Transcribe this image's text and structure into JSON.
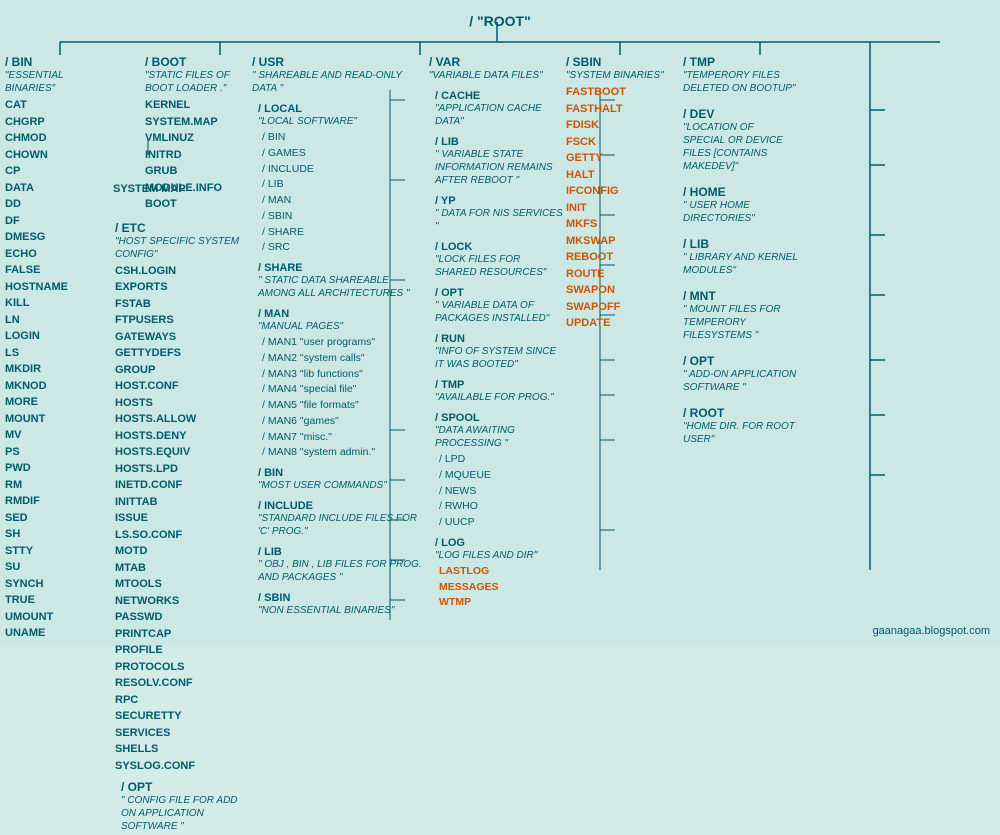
{
  "root": {
    "label": "/  \"ROOT\""
  },
  "watermark": "gaanagaa.blogspot.com",
  "columns": {
    "bin": {
      "title": "/ BIN",
      "desc": "\"ESSENTIAL BINARIES\"",
      "files": [
        "CAT",
        "CHGRP",
        "CHMOD",
        "CHOWN",
        "CP",
        "DATA",
        "DD",
        "DF",
        "DMESG",
        "ECHO",
        "FALSE",
        "HOSTNAME",
        "KILL",
        "LN",
        "LOGIN",
        "LS",
        "MKDIR",
        "MKNOD",
        "MORE",
        "MOUNT",
        "MV",
        "PS",
        "PWD",
        "RM",
        "RMDIF",
        "SED",
        "SH",
        "STTY",
        "SU",
        "SYNCH",
        "TRUE",
        "UMOUNT",
        "UNAME"
      ]
    },
    "boot": {
      "title": "/ BOOT",
      "desc": "\"STATIC FILES OF BOOT LOADER .\"",
      "files": [
        "KERNEL",
        "SYSTEM.MAP",
        "VMLINUZ",
        "INITRD",
        "GRUB",
        "MODULE.INFO",
        "BOOT"
      ]
    },
    "etc": {
      "title": "/ ETC",
      "desc": "\"HOST SPECIFIC SYSTEM CONFIG\"",
      "files": [
        "CSH.LOGIN",
        "EXPORTS",
        "FSTAB",
        "FTPUSERS",
        "GATEWAYS",
        "GETTYDEFS",
        "GROUP",
        "HOST.CONF",
        "HOSTS",
        "HOSTS.ALLOW",
        "HOSTS.DENY",
        "HOSTS.EQUIV",
        "HOSTS.LPD",
        "INETD.CONF",
        "INITTAB",
        "ISSUE",
        "LS.SO.CONF",
        "MOTD",
        "MTAB",
        "MTOOLS",
        "NETWORKS",
        "PASSWD",
        "PRINTCAP",
        "PROFILE",
        "PROTOCOLS",
        "RESOLV.CONF",
        "RPC",
        "SECURETTY",
        "SERVICES",
        "SHELLS",
        "SYSLOG.CONF"
      ]
    },
    "etc_opt": {
      "title": "/ OPT",
      "desc": "\" CONFIG FILE FOR ADD ON APPLICATION SOFTWARE \""
    },
    "usr": {
      "title": "/ USR",
      "desc": "\" SHAREABLE AND READ-ONLY DATA \"",
      "local": {
        "title": "/ LOCAL",
        "desc": "\"LOCAL SOFTWARE\"",
        "subdirs": [
          "/ BIN",
          "/ GAMES",
          "/ INCLUDE",
          "/ LIB",
          "/ MAN",
          "/ SBIN",
          "/ SHARE",
          "/ SRC"
        ]
      },
      "share": {
        "title": "/ SHARE",
        "desc": "\" STATIC DATA SHAREABLE AMONG ALL ARCHITECTURES \""
      },
      "man": {
        "title": "/ MAN",
        "desc": "\"MANUAL PAGES\"",
        "subdirs": [
          "/ MAN1 \"user programs\"",
          "/ MAN2 \"system calls\"",
          "/ MAN3 \"lib functions\"",
          "/ MAN4 \"special file\"",
          "/ MAN5 \"file formats\"",
          "/ MAN6 \"games\"",
          "/ MAN7 \"misc.\"",
          "/ MAN8 \"system admin.\""
        ]
      },
      "bin": {
        "title": "/ BIN",
        "desc": "\"MOST USER COMMANDS\""
      },
      "include": {
        "title": "/ INCLUDE",
        "desc": "\"STANDARD INCLUDE FILES FOR 'C' PROG.\""
      },
      "lib": {
        "title": "/ LIB",
        "desc": "\" OBJ , BIN , LIB FILES FOR PROG. AND PACKAGES \""
      },
      "sbin": {
        "title": "/ SBIN",
        "desc": "\"NON ESSENTIAL BINARIES\""
      }
    },
    "var": {
      "title": "/ VAR",
      "desc": "\"VARIABLE DATA FILES\"",
      "cache": {
        "title": "/ CACHE",
        "desc": "\"APPLICATION CACHE DATA\""
      },
      "lib": {
        "title": "/ LIB",
        "desc": "\" VARIABLE STATE INFORMATION REMAINS AFTER REBOOT \""
      },
      "yp": {
        "title": "/ YP",
        "desc": "\" DATA FOR NIS SERVICES \""
      },
      "lock": {
        "title": "/ LOCK",
        "desc": "\"LOCK FILES FOR SHARED RESOURCES\""
      },
      "opt": {
        "title": "/ OPT",
        "desc": "\" VARIABLE DATA OF PACKAGES INSTALLED\""
      },
      "run": {
        "title": "/ RUN",
        "desc": "\"INFO OF SYSTEM SINCE IT WAS BOOTED\""
      },
      "tmp": {
        "title": "/ TMP",
        "desc": "\"AVAILABLE FOR PROG.\""
      },
      "spool": {
        "title": "/ SPOOL",
        "desc": "\"DATA AWAITING PROCESSING \"",
        "subdirs": [
          "/ LPD",
          "/ MQUEUE",
          "/ NEWS",
          "/ RWHO",
          "/ UUCP"
        ]
      },
      "log": {
        "title": "/ LOG",
        "desc": "\"LOG FILES AND DIR\"",
        "files_orange": [
          "LASTLOG",
          "MESSAGES",
          "WTMP"
        ]
      }
    },
    "sbin": {
      "title": "/ SBIN",
      "desc": "\"SYSTEM BINARIES\"",
      "files_orange": [
        "FASTBOOT",
        "FASTHALT",
        "FDISK",
        "FSCK",
        "GETTY",
        "HALT",
        "IFCONFIG",
        "INIT",
        "MKFS",
        "MKSWAP",
        "REBOOT",
        "ROUTE",
        "SWAPON",
        "SWAPOFF",
        "UPDATE"
      ]
    },
    "right": {
      "tmp": {
        "title": "/ TMP",
        "desc": "\"TEMPERORY FILES DELETED ON BOOTUP\""
      },
      "dev": {
        "title": "/ DEV",
        "desc": "\"LOCATION OF SPECIAL OR DEVICE FILES [CONTAINS MAKEDEV]\""
      },
      "home": {
        "title": "/ HOME",
        "desc": "\" USER HOME DIRECTORIES\""
      },
      "lib": {
        "title": "/ LIB",
        "desc": "\"  LIBRARY AND KERNEL MODULES\""
      },
      "mnt": {
        "title": "/ MNT",
        "desc": "\"  MOUNT FILES FOR TEMPERORY FILESYSTEMS \""
      },
      "opt": {
        "title": "/ OPT",
        "desc": "\" ADD-ON APPLICATION SOFTWARE \""
      },
      "root": {
        "title": "/ ROOT",
        "desc": "\"HOME DIR. FOR ROOT USER\""
      }
    }
  }
}
